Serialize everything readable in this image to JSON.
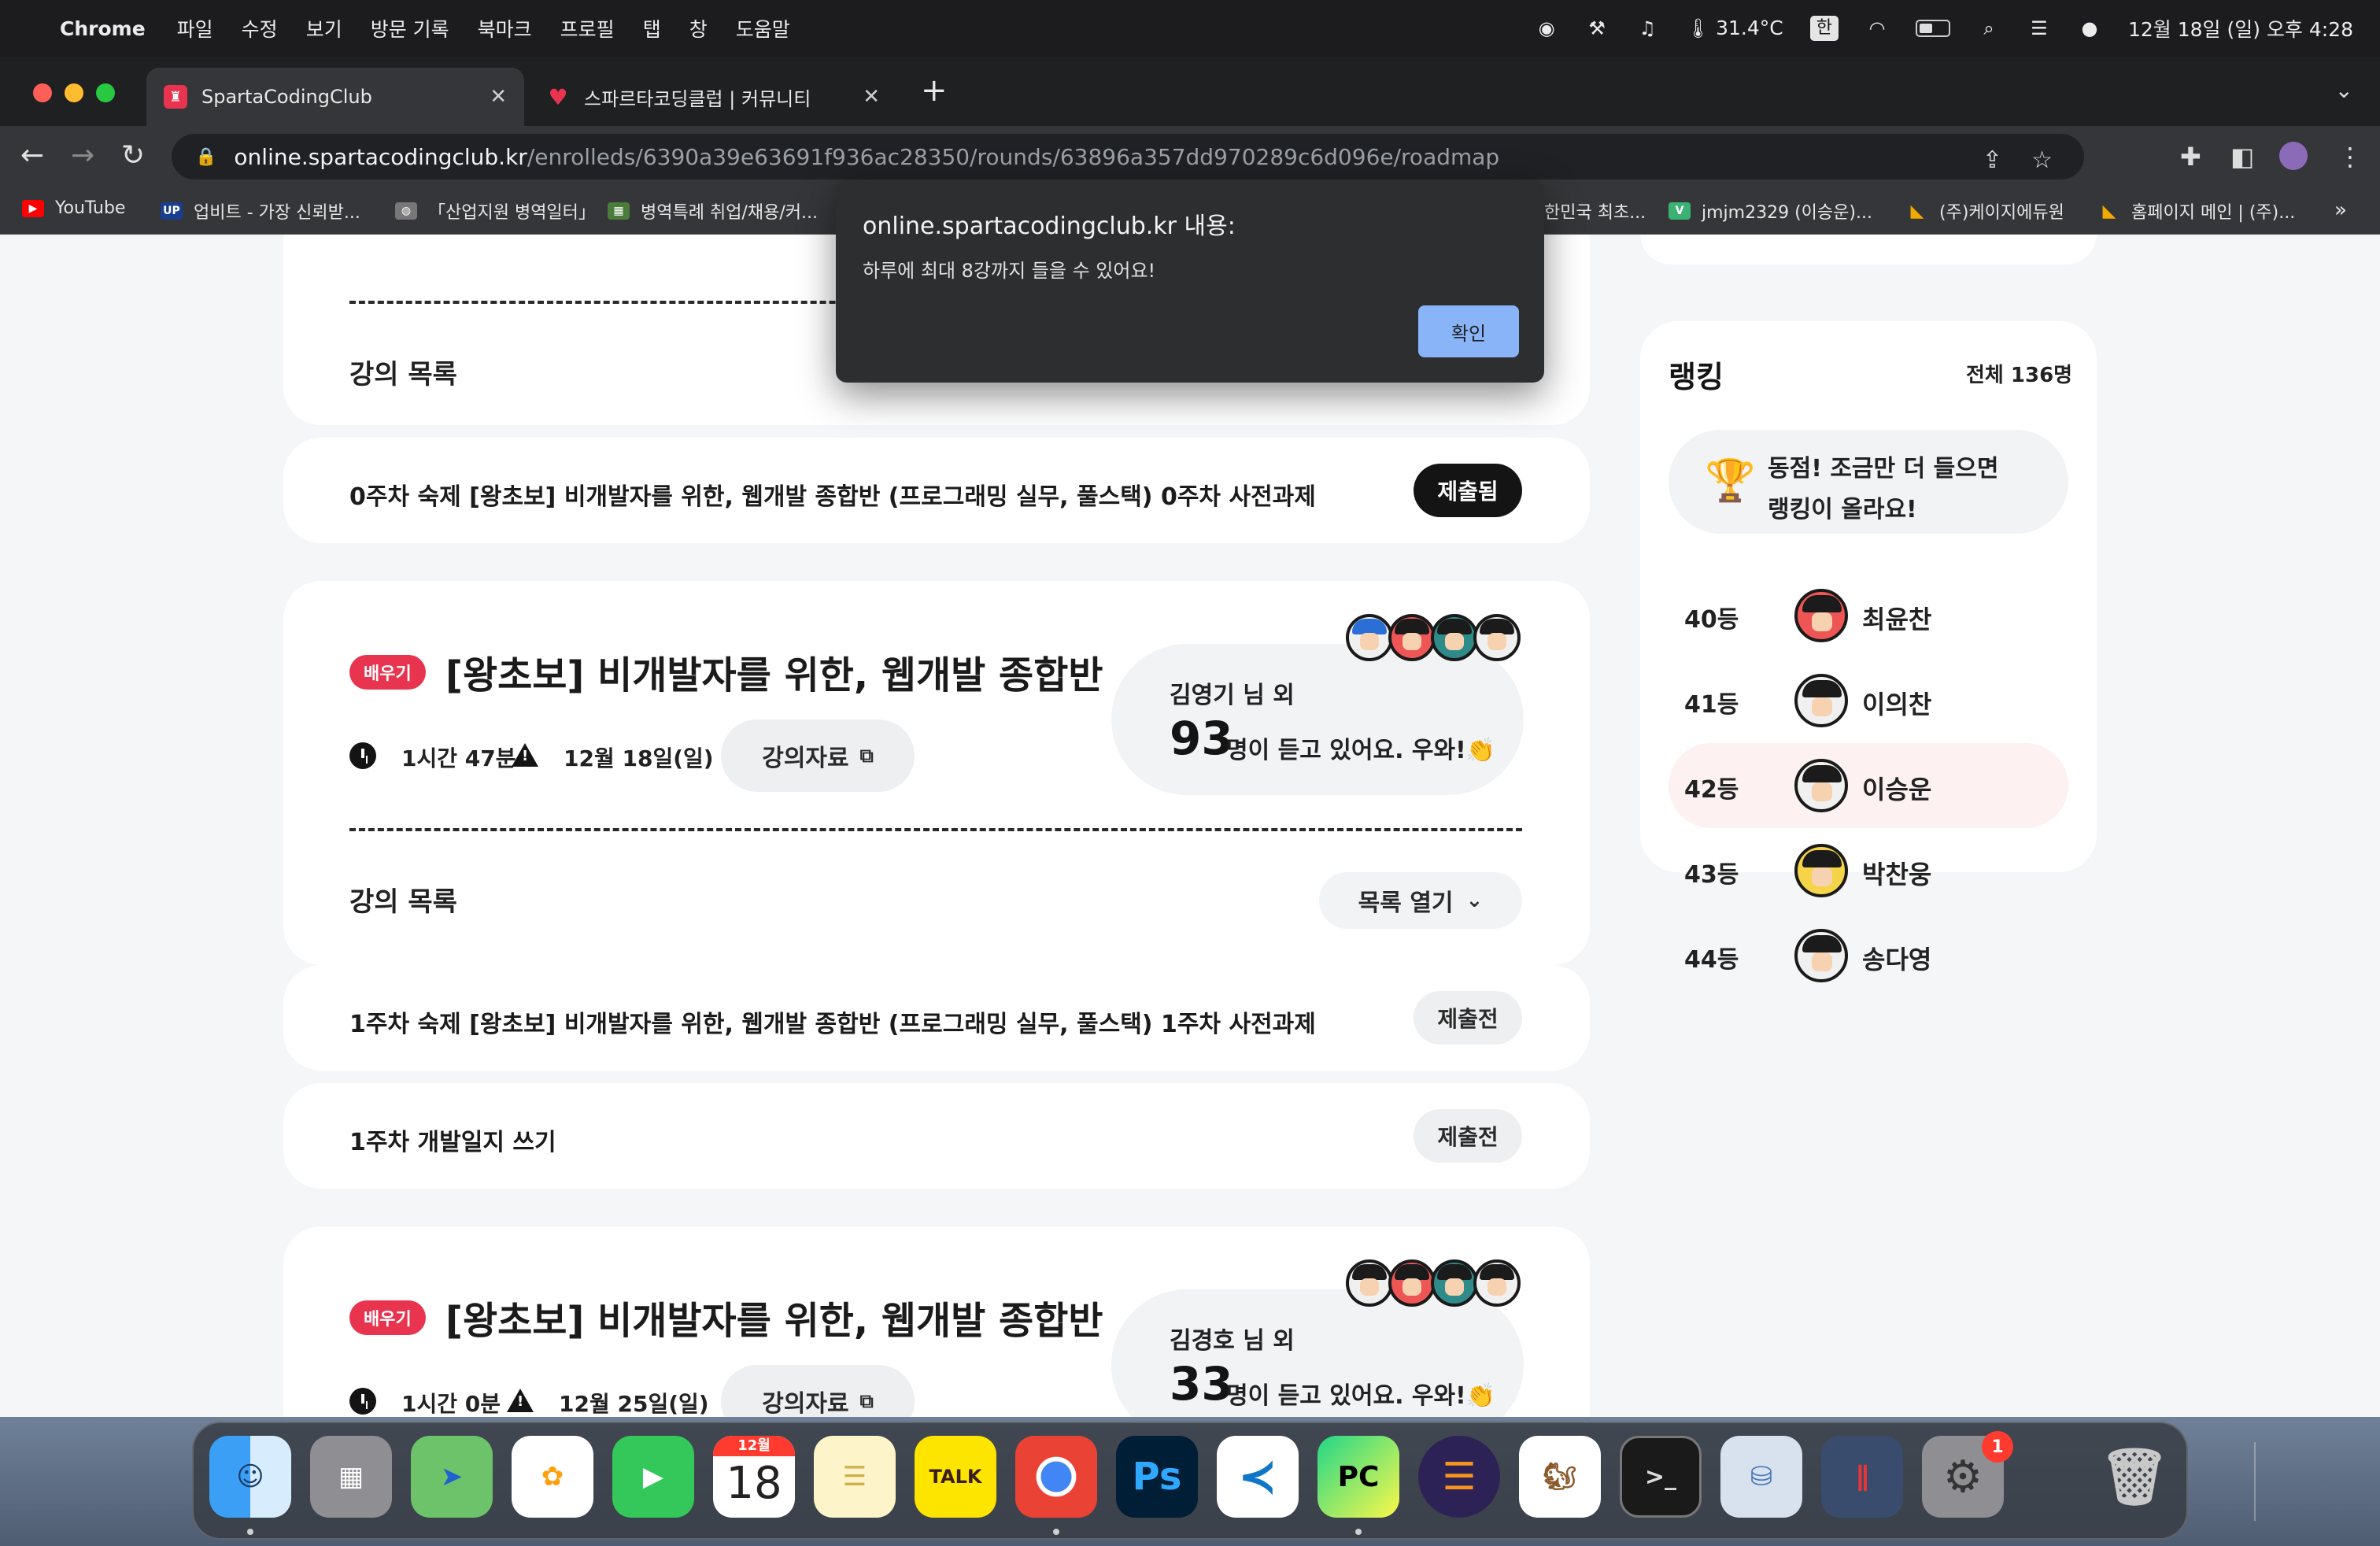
{
  "menubar": {
    "app": "Chrome",
    "items": [
      "파일",
      "수정",
      "보기",
      "방문 기록",
      "북마크",
      "프로필",
      "탭",
      "창",
      "도움말"
    ],
    "temperature": "31.4°C",
    "ime": "한",
    "datetime": "12월 18일 (일) 오후 4:28"
  },
  "tabs": [
    {
      "title": "SpartaCodingClub",
      "favicon_color": "#e8344e"
    },
    {
      "title": "스파르타코딩클럽 | 커뮤니티",
      "favicon_color": "#e8344e"
    }
  ],
  "omnibox": {
    "host": "online.spartacodingclub.kr",
    "path": "/enrolleds/6390a39e63691f936ac28350/rounds/63896a357dd970289c6d096e/roadmap"
  },
  "bookmarks": [
    {
      "label": "YouTube",
      "color": "#ff0000",
      "glyph": "▶"
    },
    {
      "label": "업비트 - 가장 신뢰받...",
      "color": "#1a3e8f",
      "glyph": "UP"
    },
    {
      "label": "「산업지원 병역일터」",
      "color": "#777777",
      "glyph": "◍"
    },
    {
      "label": "병역특례 취업/채용/커...",
      "color": "#4a7d3c",
      "glyph": "▦"
    },
    {
      "label": "한민국 최초...",
      "color": "#1e5aa8",
      "glyph": ""
    },
    {
      "label": "jmjm2329 (이승운)...",
      "color": "#3bb273",
      "glyph": "V"
    },
    {
      "label": "(주)케이지에듀원",
      "color": "#f2a900",
      "glyph": "◣"
    },
    {
      "label": "홈페이지 메인 | (주)...",
      "color": "#f2a900",
      "glyph": "◣"
    }
  ],
  "week0": {
    "list_label": "강의 목록",
    "homework": "0주차 숙제 [왕초보] 비개발자를 위한, 웹개발 종합반 (프로그래밍 실무, 풀스택) 0주차 사전과제",
    "homework_status": "제출됨"
  },
  "week1": {
    "badge": "배우기",
    "title": "[왕초보] 비개발자를 위한, 웹개발 종합반",
    "duration": "1시간 47분",
    "date": "12월 18일(일)",
    "materials": "강의자료",
    "listener_name": "김영기 님 외",
    "listener_count": "93",
    "listener_msg": "명이 듣고 있어요. 우와!👏",
    "list_label": "강의 목록",
    "list_toggle": "목록 열기",
    "homework": "1주차 숙제 [왕초보] 비개발자를 위한, 웹개발 종합반 (프로그래밍 실무, 풀스택) 1주차 사전과제",
    "homework_status": "제출전",
    "devlog": "1주차 개발일지 쓰기",
    "devlog_status": "제출전"
  },
  "week2": {
    "badge": "배우기",
    "title": "[왕초보] 비개발자를 위한, 웹개발 종합반",
    "duration": "1시간 0분",
    "date": "12월 25일(일)",
    "materials": "강의자료",
    "listener_name": "김경호 님 외",
    "listener_count": "33",
    "listener_msg": "명이 듣고 있어요. 우와!👏"
  },
  "ranking": {
    "title": "랭킹",
    "total": "전체 136명",
    "message_line1": "동점! 조금만 더 들으면",
    "message_line2": "랭킹이 올라요!",
    "rows": [
      {
        "rank": "40등",
        "name": "최윤찬"
      },
      {
        "rank": "41등",
        "name": "이의찬"
      },
      {
        "rank": "42등",
        "name": "이승운"
      },
      {
        "rank": "43등",
        "name": "박찬웅"
      },
      {
        "rank": "44등",
        "name": "송다영"
      }
    ]
  },
  "alert": {
    "title": "online.spartacodingclub.kr 내용:",
    "message": "하루에 최대 8강까지 들을 수 있어요!",
    "confirm": "확인"
  },
  "dock": {
    "calendar_month": "12월",
    "calendar_day": "18",
    "settings_badge": "1"
  },
  "colors": {
    "accent_red": "#e8344e",
    "alert_button": "#8ab4f8"
  }
}
